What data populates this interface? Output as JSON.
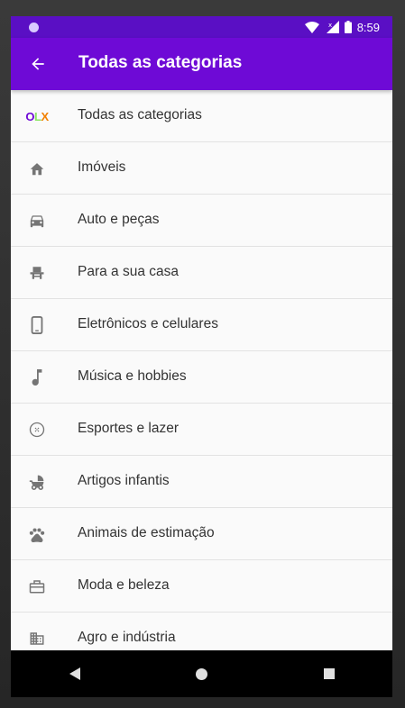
{
  "status_bar": {
    "time": "8:59"
  },
  "app_bar": {
    "title": "Todas as categorias",
    "back_icon": "arrow-back-icon"
  },
  "colors": {
    "status_bar": "#5a0fc4",
    "app_bar": "#6e0ad6",
    "icon_gray": "#757575",
    "olx_purple": "#6e0ad6",
    "olx_orange": "#f28000",
    "olx_green": "#8ce563"
  },
  "categories": [
    {
      "label": "Todas as categorias",
      "icon": "olx-logo-icon"
    },
    {
      "label": "Imóveis",
      "icon": "home-icon"
    },
    {
      "label": "Auto e peças",
      "icon": "car-icon"
    },
    {
      "label": "Para a sua casa",
      "icon": "chair-icon"
    },
    {
      "label": "Eletrônicos e celulares",
      "icon": "smartphone-icon"
    },
    {
      "label": "Música e hobbies",
      "icon": "music-note-icon"
    },
    {
      "label": "Esportes e lazer",
      "icon": "ball-icon"
    },
    {
      "label": "Artigos infantis",
      "icon": "stroller-icon"
    },
    {
      "label": "Animais de estimação",
      "icon": "paw-icon"
    },
    {
      "label": "Moda e beleza",
      "icon": "bag-icon"
    },
    {
      "label": "Agro e indústria",
      "icon": "building-icon"
    }
  ],
  "nav_bar": {
    "back": "nav-back-icon",
    "home": "nav-home-icon",
    "recents": "nav-recents-icon"
  }
}
